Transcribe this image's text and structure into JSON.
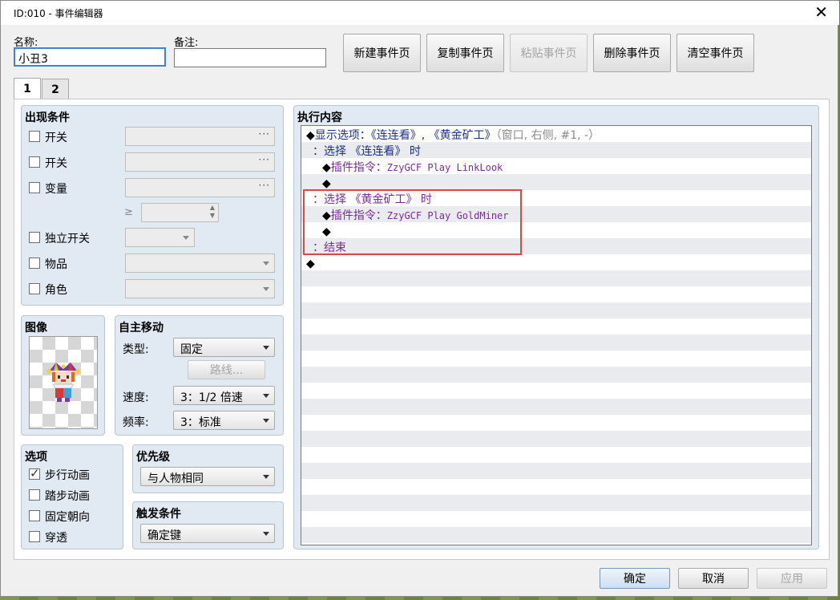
{
  "window": {
    "title": "ID:010 - 事件编辑器",
    "close_symbol": "✕"
  },
  "form": {
    "name_label": "名称:",
    "name_value": "小丑3",
    "note_label": "备注:",
    "note_value": ""
  },
  "toolbar": {
    "new_page": "新建事件页",
    "copy_page": "复制事件页",
    "paste_page": "粘贴事件页",
    "delete_page": "删除事件页",
    "clear_page": "清空事件页"
  },
  "tabs": [
    {
      "label": "1",
      "active": true
    },
    {
      "label": "2",
      "active": false
    }
  ],
  "conditions": {
    "title": "出现条件",
    "switch1": "开关",
    "switch2": "开关",
    "variable": "变量",
    "gte": "≥",
    "self_switch": "独立开关",
    "item": "物品",
    "actor": "角色",
    "dots": "···"
  },
  "image": {
    "title": "图像",
    "sprite": "jester-sprite"
  },
  "autonomous": {
    "title": "自主移动",
    "type_label": "类型:",
    "type_value": "固定",
    "route_button": "路线...",
    "speed_label": "速度:",
    "speed_value": "3：1/2 倍速",
    "freq_label": "频率:",
    "freq_value": "3：标准"
  },
  "options": {
    "title": "选项",
    "walking": {
      "label": "步行动画",
      "checked": true
    },
    "stepping": {
      "label": "踏步动画",
      "checked": false
    },
    "direction_fix": {
      "label": "固定朝向",
      "checked": false
    },
    "through": {
      "label": "穿透",
      "checked": false
    }
  },
  "priority": {
    "title": "优先级",
    "value": "与人物相同"
  },
  "trigger": {
    "title": "触发条件",
    "value": "确定键"
  },
  "contents": {
    "title": "执行内容",
    "lines": [
      {
        "indent": 0,
        "parts": [
          {
            "t": "◆",
            "c": ""
          },
          {
            "t": "显示选项：《连连看》, 《黄金矿工》",
            "c": "blue"
          },
          {
            "t": "（窗口, 右侧, #1, -）",
            "c": "gray"
          }
        ]
      },
      {
        "indent": 1,
        "parts": [
          {
            "t": "：选择 《连连看》 时",
            "c": "blue"
          }
        ]
      },
      {
        "indent": 2,
        "parts": [
          {
            "t": "◆",
            "c": ""
          },
          {
            "t": "插件指令：",
            "c": "purple"
          },
          {
            "t": "ZzyGCF Play LinkLook",
            "c": "purple mono"
          }
        ]
      },
      {
        "indent": 2,
        "parts": [
          {
            "t": "◆",
            "c": ""
          }
        ]
      },
      {
        "indent": 1,
        "parts": [
          {
            "t": "：选择 《黄金矿工》 时",
            "c": "purple"
          }
        ]
      },
      {
        "indent": 2,
        "parts": [
          {
            "t": "◆",
            "c": ""
          },
          {
            "t": "插件指令：",
            "c": "purple"
          },
          {
            "t": "ZzyGCF Play GoldMiner",
            "c": "purple mono"
          }
        ]
      },
      {
        "indent": 2,
        "parts": [
          {
            "t": "◆",
            "c": ""
          }
        ]
      },
      {
        "indent": 1,
        "parts": [
          {
            "t": "：结束",
            "c": "purple"
          }
        ]
      },
      {
        "indent": 0,
        "parts": [
          {
            "t": "◆",
            "c": ""
          }
        ]
      }
    ]
  },
  "footer": {
    "ok": "确定",
    "cancel": "取消",
    "apply": "应用"
  }
}
